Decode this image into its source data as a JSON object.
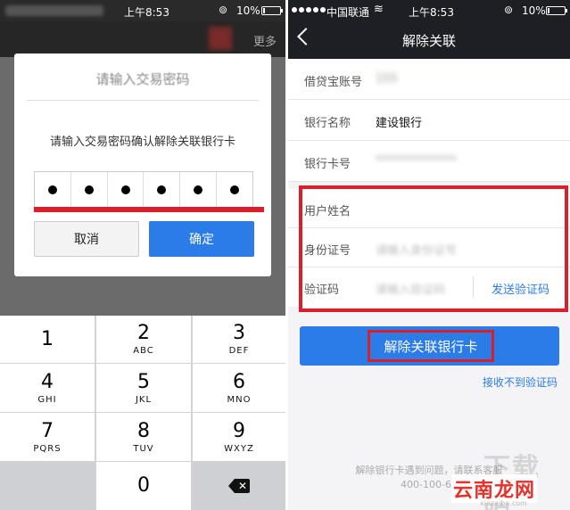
{
  "left": {
    "status": {
      "time": "上午8:53",
      "battery_pct": "10%",
      "battery_level": 0.1
    },
    "header": {
      "more": "更多"
    },
    "dialog": {
      "title": "请输入交易密码",
      "prompt": "请输入交易密码确认解除关联银行卡",
      "pin_dots": 6,
      "cancel_label": "取消",
      "ok_label": "确定"
    },
    "keypad": {
      "keys": [
        {
          "num": "1",
          "letters": ""
        },
        {
          "num": "2",
          "letters": "ABC"
        },
        {
          "num": "3",
          "letters": "DEF"
        },
        {
          "num": "4",
          "letters": "GHI"
        },
        {
          "num": "5",
          "letters": "JKL"
        },
        {
          "num": "6",
          "letters": "MNO"
        },
        {
          "num": "7",
          "letters": "PQRS"
        },
        {
          "num": "8",
          "letters": "TUV"
        },
        {
          "num": "9",
          "letters": "WXYZ"
        },
        {
          "num": "",
          "letters": ""
        },
        {
          "num": "0",
          "letters": ""
        },
        {
          "num": "",
          "letters": ""
        }
      ]
    }
  },
  "right": {
    "status": {
      "carrier": "中国联通",
      "time": "上午8:53",
      "battery_pct": "10%",
      "battery_level": 0.1
    },
    "nav": {
      "title": "解除关联"
    },
    "info": [
      {
        "label": "借贷宝账号",
        "value": "155"
      },
      {
        "label": "银行名称",
        "value": "建设银行"
      },
      {
        "label": "银行卡号",
        "value": "**************"
      }
    ],
    "form": {
      "name_label": "用户姓名",
      "id_label": "身份证号",
      "id_placeholder": "请输入身份证号",
      "code_label": "验证码",
      "code_placeholder": "请输入验证码",
      "send_code": "发送验证码"
    },
    "unbind_button": "解除关联银行卡",
    "no_code_link": "接收不到验证码",
    "footer_line1": "解除银行卡遇到问题，请联系客服",
    "footer_line2": "400-100-66"
  },
  "watermark": {
    "text": "云南龙网",
    "sub": "xiazaiba.com",
    "ghost": "下载吧"
  },
  "colors": {
    "accent": "#2b7ce6",
    "highlight": "#d9202a",
    "dark_bar": "#1e1f25"
  }
}
